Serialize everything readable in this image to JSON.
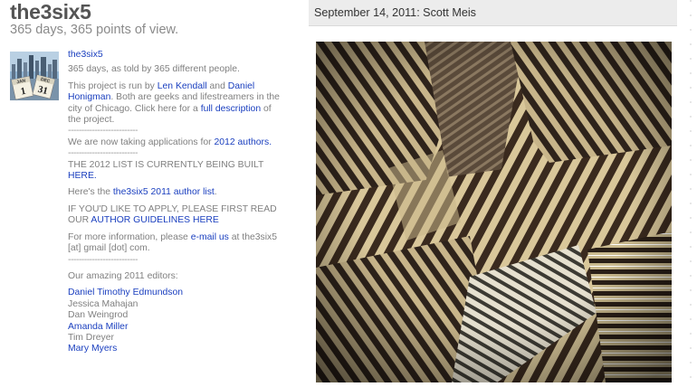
{
  "header": {
    "title": "the3six5",
    "tagline": "365 days, 365 points of view."
  },
  "sidebar": {
    "blog_name": "the3six5",
    "intro": "365 days, as told by 365 different people.",
    "project": {
      "t1": "This project is run by ",
      "len": "Len Kendall",
      "t2": " and ",
      "daniel": "Daniel Honigman",
      "t3": ". Both are geeks and lifestreamers in the city of Chicago. Click here for a ",
      "full": "full description",
      "t4": " of the project."
    },
    "divider": "--------------------------",
    "applications": {
      "t1": "We are now taking applications for ",
      "link": "2012 authors."
    },
    "list_building": {
      "text": "THE 2012 LIST IS CURRENTLY BEING BUILT",
      "link": "HERE."
    },
    "author_list": {
      "t1": "Here's the ",
      "link": "the3six5 2011 author list",
      "t2": "."
    },
    "guidelines": {
      "text": "IF YOU'D LIKE TO APPLY, PLEASE FIRST READ OUR ",
      "link": "AUTHOR GUIDELINES HERE"
    },
    "info": {
      "t1": "For more information, please ",
      "link": "e-mail us",
      "t2": " at the3six5 [at] gmail [dot] com."
    },
    "editors_heading": "Our amazing 2011 editors:",
    "editors": [
      {
        "name": "Daniel Timothy Edmundson",
        "link": true
      },
      {
        "name": "Jessica Mahajan",
        "link": false
      },
      {
        "name": "Dan Weingrod",
        "link": false
      },
      {
        "name": "Amanda Miller",
        "link": true
      },
      {
        "name": "Tim Dreyer",
        "link": false
      },
      {
        "name": "Mary Myers",
        "link": true
      }
    ]
  },
  "post": {
    "title": "September 14, 2011: Scott Meis"
  },
  "avatar": {
    "month1": "JAN",
    "day1": "1",
    "month2": "DEC",
    "day2": "31"
  }
}
